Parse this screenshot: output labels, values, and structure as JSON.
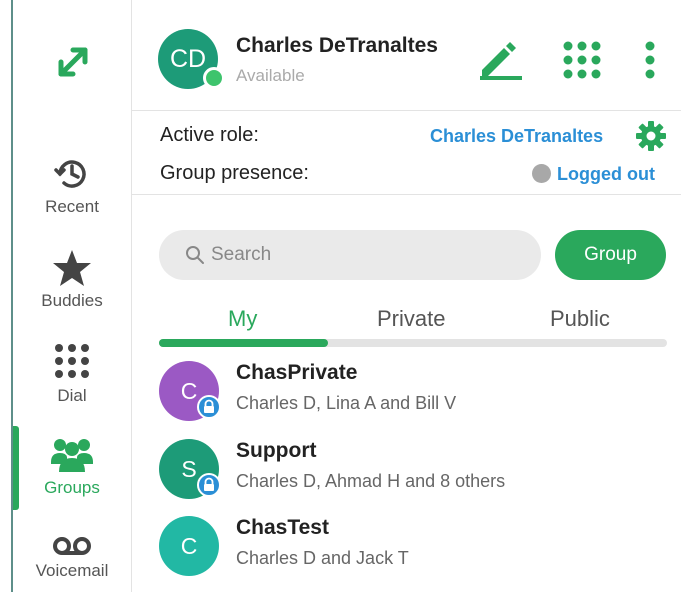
{
  "colors": {
    "accent": "#2aa85c",
    "link": "#2b8fd6"
  },
  "sidebar": {
    "items": [
      {
        "label": "Recent",
        "icon": "clock-history-icon"
      },
      {
        "label": "Buddies",
        "icon": "star-icon"
      },
      {
        "label": "Dial",
        "icon": "dialpad-icon"
      },
      {
        "label": "Groups",
        "icon": "groups-icon",
        "active": true
      },
      {
        "label": "Voicemail",
        "icon": "voicemail-icon"
      }
    ]
  },
  "header": {
    "initials": "CD",
    "name": "Charles DeTranaltes",
    "status": "Available"
  },
  "roles": {
    "active_role_label": "Active role:",
    "active_role_value": "Charles DeTranaltes",
    "group_presence_label": "Group presence:",
    "group_presence_value": "Logged out"
  },
  "search": {
    "placeholder": "Search"
  },
  "group_button": "Group",
  "tabs": [
    {
      "label": "My",
      "active": true
    },
    {
      "label": "Private"
    },
    {
      "label": "Public"
    }
  ],
  "groups": [
    {
      "initial": "C",
      "name": "ChasPrivate",
      "members": "Charles D, Lina A and Bill V",
      "color": "#9b59c4",
      "locked": true
    },
    {
      "initial": "S",
      "name": "Support",
      "members": "Charles D, Ahmad H and 8 others",
      "color": "#1d9b78",
      "locked": true
    },
    {
      "initial": "C",
      "name": "ChasTest",
      "members": "Charles D and Jack T",
      "color": "#22b8a4",
      "locked": false
    }
  ]
}
